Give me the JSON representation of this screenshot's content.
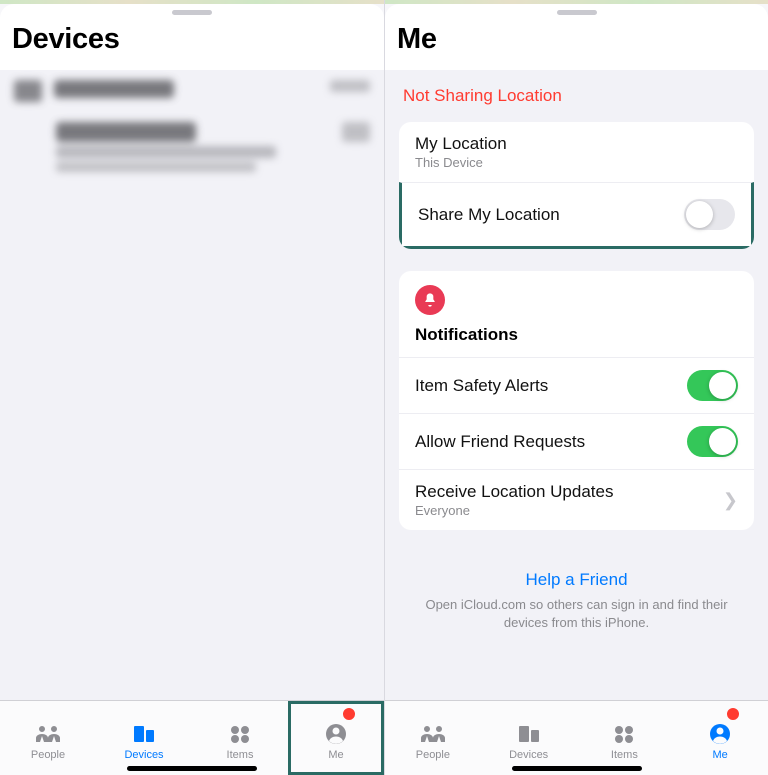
{
  "colors": {
    "accent": "#007aff",
    "danger": "#ff3b30",
    "switch_on": "#34c759",
    "highlight": "#2a6b64"
  },
  "left": {
    "title": "Devices",
    "tabs": [
      {
        "key": "people",
        "label": "People",
        "active": false,
        "badge": false
      },
      {
        "key": "devices",
        "label": "Devices",
        "active": true,
        "badge": false
      },
      {
        "key": "items",
        "label": "Items",
        "active": false,
        "badge": false
      },
      {
        "key": "me",
        "label": "Me",
        "active": false,
        "badge": true,
        "highlight": true
      }
    ]
  },
  "right": {
    "title": "Me",
    "status": "Not Sharing Location",
    "location_group": {
      "my_location_title": "My Location",
      "my_location_sub": "This Device",
      "share_title": "Share My Location",
      "share_on": false,
      "share_highlight": true
    },
    "notifications": {
      "header": "Notifications",
      "item_safety": {
        "title": "Item Safety Alerts",
        "on": true
      },
      "friend_requests": {
        "title": "Allow Friend Requests",
        "on": true
      },
      "receive_updates": {
        "title": "Receive Location Updates",
        "sub": "Everyone"
      }
    },
    "help": {
      "link": "Help a Friend",
      "sub": "Open iCloud.com so others can sign in and find their devices from this iPhone."
    },
    "tabs": [
      {
        "key": "people",
        "label": "People",
        "active": false,
        "badge": false
      },
      {
        "key": "devices",
        "label": "Devices",
        "active": false,
        "badge": false
      },
      {
        "key": "items",
        "label": "Items",
        "active": false,
        "badge": false
      },
      {
        "key": "me",
        "label": "Me",
        "active": true,
        "badge": true
      }
    ]
  }
}
